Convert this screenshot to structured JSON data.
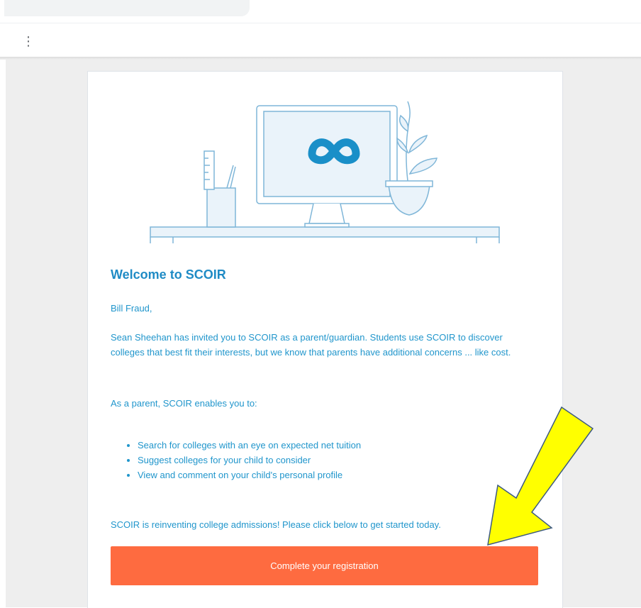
{
  "toolbar": {
    "more_icon": "⋮"
  },
  "email": {
    "logo_icon": "scoir-infinity-icon",
    "title": "Welcome to SCOIR",
    "greeting": "Bill Fraud,",
    "intro": "Sean Sheehan has invited you to SCOIR as a parent/guardian. Students use SCOIR to discover colleges that best fit their interests, but we know that parents have additional concerns ... like cost.",
    "enables_lead": "As a parent, SCOIR enables you to:",
    "bullets": [
      "Search for colleges with an eye on expected net tuition",
      "Suggest colleges for your child to consider",
      "View and comment on your child's personal profile"
    ],
    "closing": "SCOIR is reinventing college admissions! Please click below to get started today.",
    "cta_label": "Complete your registration",
    "cta_color": "#fe6b40",
    "text_color": "#2196cc",
    "title_color": "#1f8bc5"
  },
  "annotation": {
    "arrow_color": "#ffff00"
  }
}
